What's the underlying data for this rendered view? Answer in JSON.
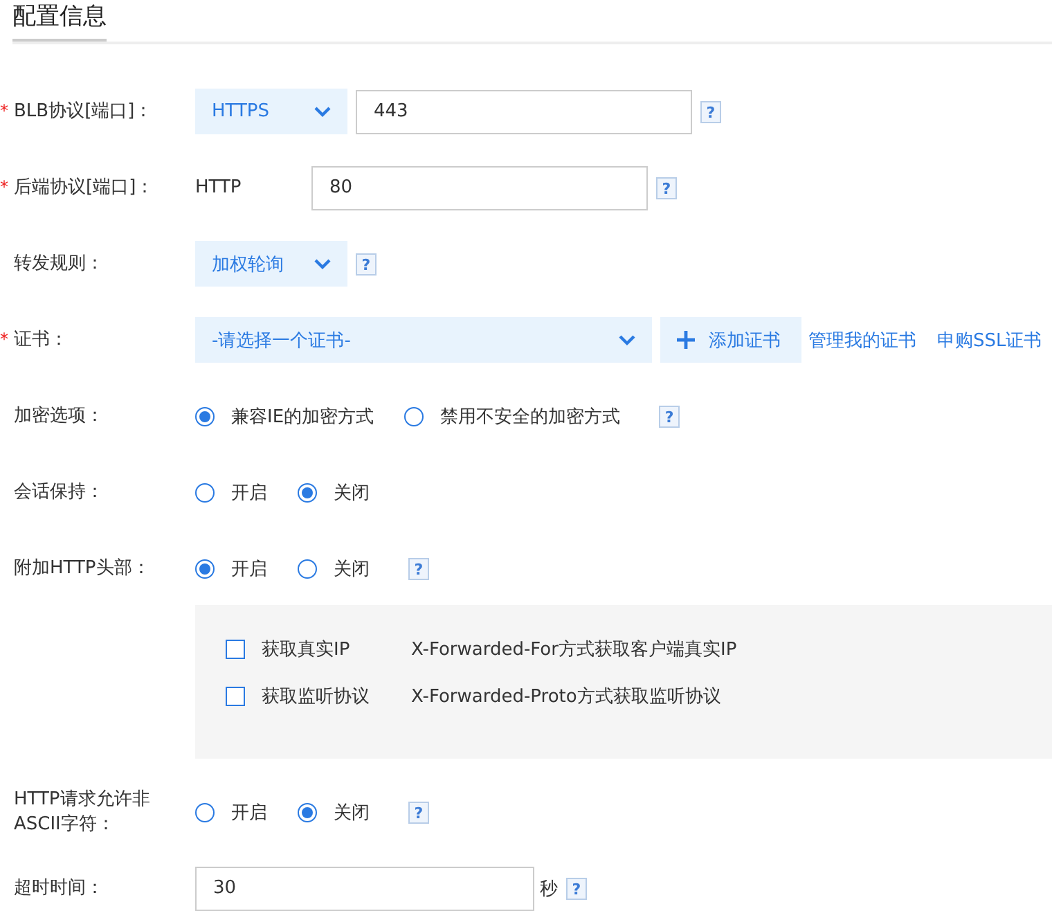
{
  "heading": "配置信息",
  "rows": [
    {
      "kind": "select-input",
      "label": "BLB协议[端口]：",
      "required_mark": "*",
      "select": "HTTPS",
      "value": "443",
      "help": "?"
    },
    {
      "kind": "text-input",
      "label": "后端协议[端口]：",
      "required_mark": "*",
      "text": "HTTP",
      "value": "80",
      "help": "?"
    },
    {
      "kind": "select",
      "label": "转发规则：",
      "select": "加权轮询",
      "help": "?"
    },
    {
      "kind": "cert",
      "label": "证书：",
      "required_mark": "*",
      "select": "-请选择一个证书-",
      "add_button": "添加证书",
      "links": [
        "管理我的证书",
        "申购SSL证书"
      ]
    },
    {
      "kind": "radio",
      "label": "加密选项：",
      "options": [
        {
          "label": "兼容IE的加密方式",
          "selected": true
        },
        {
          "label": "禁用不安全的加密方式",
          "selected": false
        }
      ],
      "help": "?"
    },
    {
      "kind": "radio",
      "label": "会话保持：",
      "options": [
        {
          "label": "开启",
          "selected": false
        },
        {
          "label": "关闭",
          "selected": true
        }
      ]
    },
    {
      "kind": "radio",
      "label": "附加HTTP头部：",
      "options": [
        {
          "label": "开启",
          "selected": true
        },
        {
          "label": "关闭",
          "selected": false
        }
      ],
      "help": "?",
      "panel": [
        {
          "label": "获取真实IP",
          "description": "X-Forwarded-For方式获取客户端真实IP",
          "checked": false
        },
        {
          "label": "获取监听协议",
          "description": "X-Forwarded-Proto方式获取监听协议",
          "checked": false
        }
      ]
    },
    {
      "kind": "radio",
      "label": "HTTP请求允许非ASCII字符：",
      "options": [
        {
          "label": "开启",
          "selected": false
        },
        {
          "label": "关闭",
          "selected": true
        }
      ],
      "help": "?"
    },
    {
      "kind": "input-unit",
      "label": "超时时间：",
      "value": "30",
      "unit": "秒",
      "help": "?"
    }
  ]
}
